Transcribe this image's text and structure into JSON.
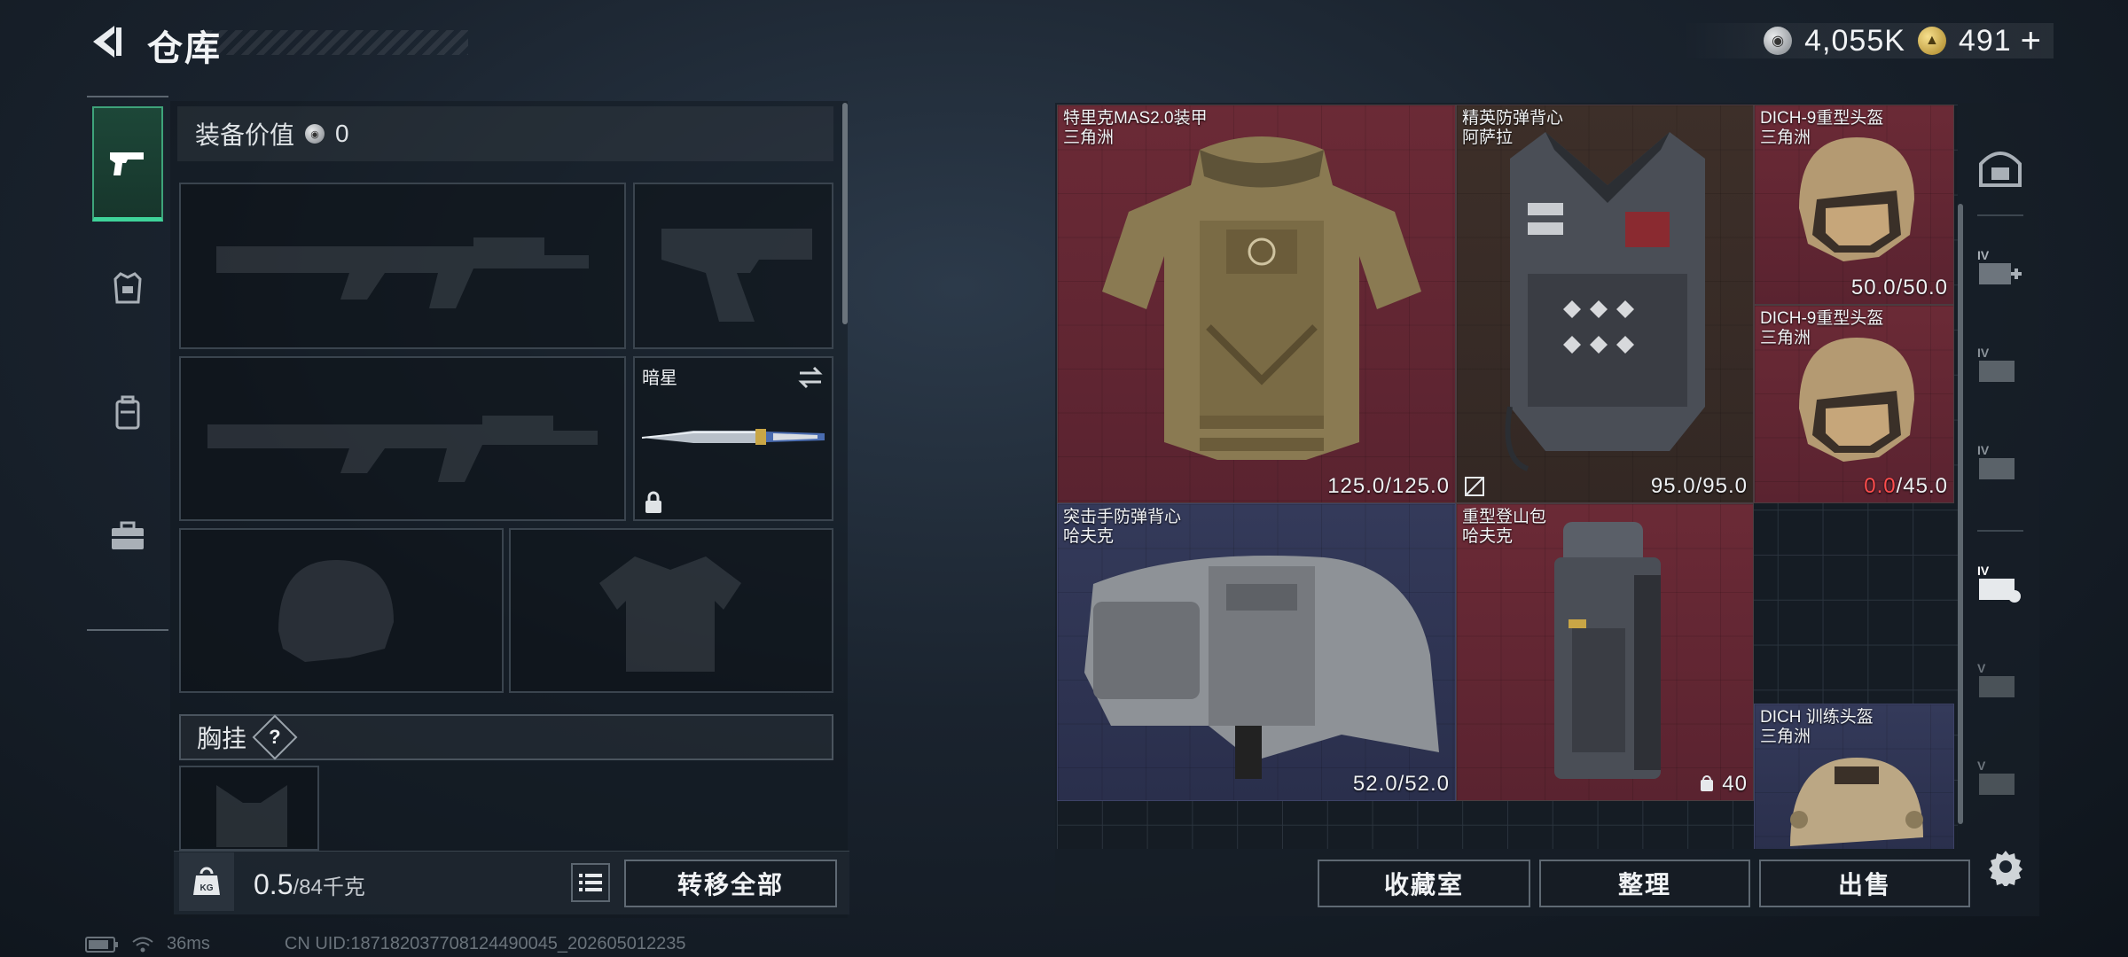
{
  "header": {
    "title": "仓库",
    "silver_value": "4,055K",
    "gold_value": "491",
    "plus_label": "+"
  },
  "equipment": {
    "value_label": "装备价值",
    "value": "0",
    "knife_name": "暗星",
    "chest_rig_label": "胸挂",
    "chest_rig_help": "?",
    "weight_current": "0.5",
    "weight_max": "/84千克",
    "transfer_all": "转移全部"
  },
  "stash": {
    "items": [
      {
        "name": "特里克MAS2.0装甲",
        "sub": "三角洲",
        "durability": "125.0/125.0",
        "color": "#6b2a36"
      },
      {
        "name": "精英防弹背心",
        "sub": "阿萨拉",
        "durability": "95.0/95.0",
        "color": "#3d2f29"
      },
      {
        "name": "DICH-9重型头盔",
        "sub": "三角洲",
        "durability": "50.0/50.0",
        "color": "#6b2a36"
      },
      {
        "name": "DICH-9重型头盔",
        "sub": "三角洲",
        "durability_low": "0.0",
        "durability_max": "/45.0",
        "color": "#6b2a36"
      },
      {
        "name": "突击手防弹背心",
        "sub": "哈夫克",
        "durability": "52.0/52.0",
        "color": "#343a5a"
      },
      {
        "name": "重型登山包",
        "sub": "哈夫克",
        "capacity": "40",
        "color": "#6b2a36"
      },
      {
        "name": "DICH 训练头盔",
        "sub": "三角洲",
        "color": "#343a5a"
      }
    ],
    "collection_button": "收藏室",
    "sort_button": "整理",
    "sell_button": "出售"
  },
  "status": {
    "ping": "36ms",
    "uid": "CN UID:18718203770812449004​5_202605012235"
  },
  "icons": {
    "back": "back-arrow-icon",
    "silver": "silver-coin-icon",
    "gold": "gold-coin-icon",
    "weapon_tab": "pistol-icon",
    "armor_tab": "armor-icon",
    "backpack_tab": "backpack-icon",
    "case_tab": "case-icon",
    "settings": "gear-icon"
  }
}
